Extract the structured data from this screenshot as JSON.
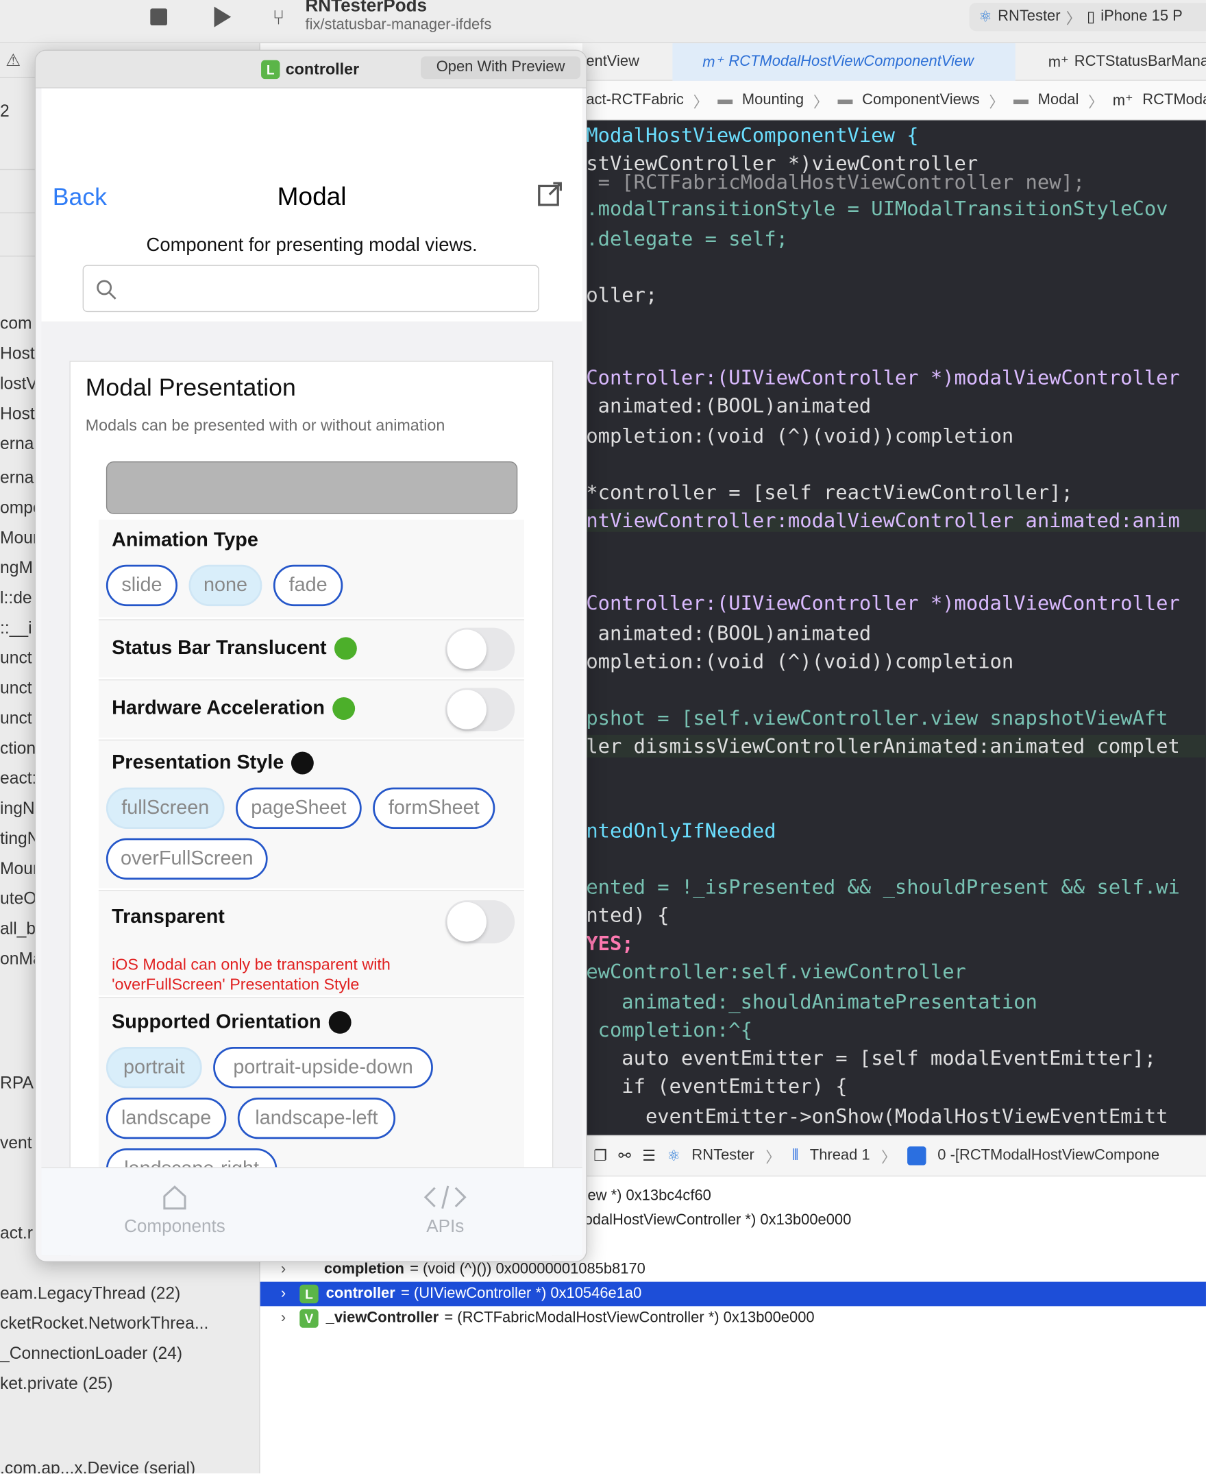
{
  "toolbar": {
    "project_name": "RNTesterPods",
    "branch": "fix/statusbar-manager-ifdefs",
    "scheme": "RNTester",
    "device": "iPhone 15 P"
  },
  "sidebar": {
    "lines": [
      "2",
      "com",
      "Host\\",
      "lostV",
      "Host\\",
      "ernal",
      "ernal",
      "ompo",
      "Moun",
      "ngM",
      "l::de",
      "::__i",
      "unct",
      "unct",
      "unct",
      "ction",
      "eact:",
      "ingN",
      "tingN",
      "Moun",
      "uteO",
      "all_b",
      "onMa",
      "RPA",
      "vent",
      "act.r",
      "eam.LegacyThread (22)",
      "cketRocket.NetworkThrea...",
      "_ConnectionLoader (24)",
      "ket.private (25)",
      ".com.ap...x.Device (serial)"
    ]
  },
  "editor": {
    "tabs": [
      "entView",
      "RCTModalHostViewComponentView",
      "RCTStatusBarMana"
    ],
    "breadcrumbs": [
      "act-RCTFabric",
      "Mounting",
      "ComponentViews",
      "Modal",
      "RCTModalH"
    ]
  },
  "code_lines": [
    "ModalHostViewComponentView {",
    "stViewController *)viewController",
    " = [RCTFabricModalHostViewController new];",
    ".modalTransitionStyle = UIModalTransitionStyleCov",
    ".delegate = self;",
    "oller;",
    "Controller:(UIViewController *)modalViewController",
    " animated:(BOOL)animated",
    "ompletion:(void (^)(void))completion",
    "*controller = [self reactViewController];",
    "ntViewController:modalViewController animated:anim",
    "Controller:(UIViewController *)modalViewController",
    " animated:(BOOL)animated",
    "ompletion:(void (^)(void))completion",
    "pshot = [self.viewController.view snapshotViewAft",
    "ler dismissViewControllerAnimated:animated complet",
    "ntedOnlyIfNeeded",
    "ented = !_isPresented && _shouldPresent && self.wi",
    "nted) {",
    "YES;",
    "ewController:self.viewController",
    "   animated:_shouldAnimatePresentation",
    " completion:^{",
    "   auto eventEmitter = [self modalEventEmitter];",
    "   if (eventEmitter) {",
    "     eventEmitter->onShow(ModalHostViewEventEmitt"
  ],
  "debug_bar": {
    "scheme": "RNTester",
    "thread": "Thread 1",
    "frame": "0 -[RCTModalHostViewCompone"
  },
  "variables": [
    {
      "text": "iew *) 0x13bc4cf60"
    },
    {
      "text": "odalHostViewController *) 0x13b00e000"
    },
    {
      "name": "completion",
      "type": "= (void (^)()) 0x00000001085b8170"
    },
    {
      "badge": "L",
      "name": "controller",
      "type": "= (UIViewController *) 0x10546e1a0"
    },
    {
      "badge": "V",
      "name": "_viewController",
      "type": "= (RCTFabricModalHostViewController *) 0x13b00e000"
    }
  ],
  "simulator": {
    "window_badge": "L",
    "window_title": "controller",
    "open_preview": "Open With Preview",
    "nav": {
      "back": "Back",
      "title": "Modal"
    },
    "subtitle": "Component for presenting modal views.",
    "search_placeholder": "",
    "card": {
      "title": "Modal Presentation",
      "description": "Modals can be presented with or without animation"
    },
    "animation_type": {
      "label": "Animation Type",
      "options": [
        "slide",
        "none",
        "fade"
      ],
      "selected": "none"
    },
    "status_bar": {
      "label": "Status Bar Translucent",
      "dot_color": "#4caf2a",
      "value": false
    },
    "hardware": {
      "label": "Hardware Acceleration",
      "dot_color": "#4caf2a",
      "value": false
    },
    "presentation_style": {
      "label": "Presentation Style",
      "dot_color": "#111111",
      "options": [
        "fullScreen",
        "pageSheet",
        "formSheet",
        "overFullScreen"
      ],
      "selected": "fullScreen"
    },
    "transparent": {
      "label": "Transparent",
      "value": false,
      "warning": "iOS Modal can only be transparent with 'overFullScreen' Presentation Style"
    },
    "orientation": {
      "label": "Supported Orientation",
      "dot_color": "#111111",
      "options": [
        "portrait",
        "portrait-upside-down",
        "landscape",
        "landscape-left",
        "landscape-right"
      ],
      "selected": [
        "portrait"
      ]
    },
    "tabbar": {
      "components": "Components",
      "apis": "APIs"
    }
  },
  "colors": {
    "accent": "#2f7cf6",
    "pill_border": "#2456c9",
    "warning": "#e02020",
    "selection": "#1d4ed8"
  }
}
